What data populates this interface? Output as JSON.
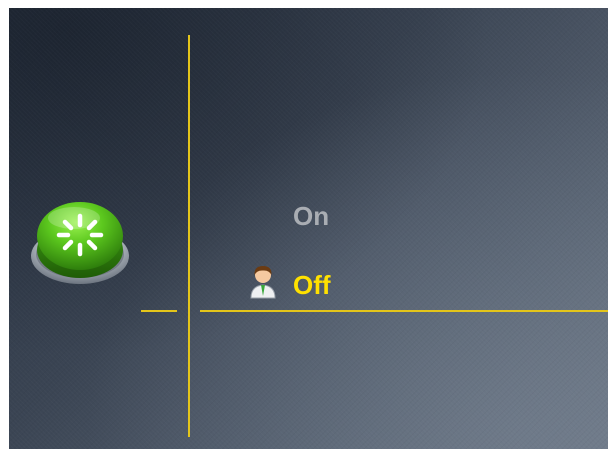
{
  "menu": {
    "options": [
      {
        "label": "On",
        "selected": false
      },
      {
        "label": "Off",
        "selected": true
      }
    ]
  },
  "icons": {
    "power_button": "restart-power-icon",
    "current_user": "user-avatar-icon"
  },
  "colors": {
    "accent_line": "#e4c51a",
    "selected_text": "#ffe100",
    "unselected_text": "#a9adb3",
    "button_green": "#5cc81e"
  }
}
